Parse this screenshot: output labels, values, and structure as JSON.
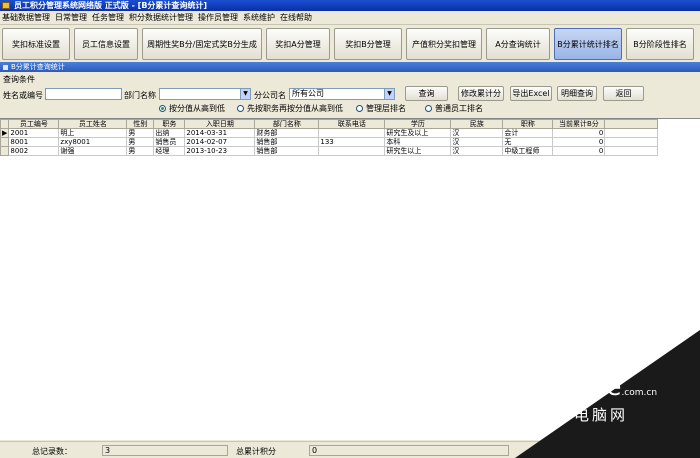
{
  "window": {
    "title": "员工积分管理系统网络版 正式版 - [B分累计查询统计]"
  },
  "menu": [
    "基础数据管理",
    "日常管理",
    "任务管理",
    "积分数据统计管理",
    "操作员管理",
    "系统维护",
    "在线帮助"
  ],
  "toolbar": {
    "buttons": [
      {
        "label": "奖扣标准设置"
      },
      {
        "label": "员工信息设置"
      },
      {
        "label": "周期性奖B分/固定式奖B分生成"
      },
      {
        "label": "奖扣A分管理"
      },
      {
        "label": "奖扣B分管理"
      },
      {
        "label": "产值积分奖扣管理"
      },
      {
        "label": "A分查询统计"
      },
      {
        "label": "B分累计统计排名"
      },
      {
        "label": "B分阶段性排名"
      }
    ]
  },
  "section": {
    "title": "B分累计查询统计"
  },
  "query": {
    "group_label": "查询条件",
    "name_label": "姓名或编号",
    "name_value": "",
    "dept_label": "部门名称",
    "dept_value": "",
    "company_label": "分公司名",
    "company_value": "所有公司",
    "buttons": {
      "query": "查询",
      "modify": "修改累计分",
      "export": "导出Excel",
      "detail": "明细查询",
      "back": "返回"
    },
    "radios": [
      {
        "label": "按分值从高到低",
        "checked": true
      },
      {
        "label": "先按职务再按分值从高到低",
        "checked": false
      },
      {
        "label": "管理层排名",
        "checked": false
      },
      {
        "label": "普通员工排名",
        "checked": false
      }
    ]
  },
  "table": {
    "columns": [
      "员工编号",
      "员工姓名",
      "性别",
      "职务",
      "入职日期",
      "部门名称",
      "联系电话",
      "学历",
      "民族",
      "职称",
      "当前累计B分"
    ],
    "rows": [
      [
        "2001",
        "明上",
        "男",
        "出纳",
        "2014-03-31",
        "财务部",
        "",
        "研究生及以上",
        "汉",
        "会计",
        "0"
      ],
      [
        "8001",
        "zxy8001",
        "男",
        "销售员",
        "2014-02-07",
        "销售部",
        "133",
        "本科",
        "汉",
        "无",
        "0"
      ],
      [
        "8002",
        "谢强",
        "男",
        "经理",
        "2013-10-23",
        "销售部",
        "",
        "研究生以上",
        "汉",
        "中级工程师",
        "0"
      ]
    ]
  },
  "status": {
    "total_label": "总记录数：",
    "total_value": "3",
    "sum_label": "总累计积分",
    "sum_value": "0"
  },
  "watermark": {
    "logo": "PConline",
    "logo_suffix": ".com.cn",
    "sub": "太平洋电脑网"
  }
}
